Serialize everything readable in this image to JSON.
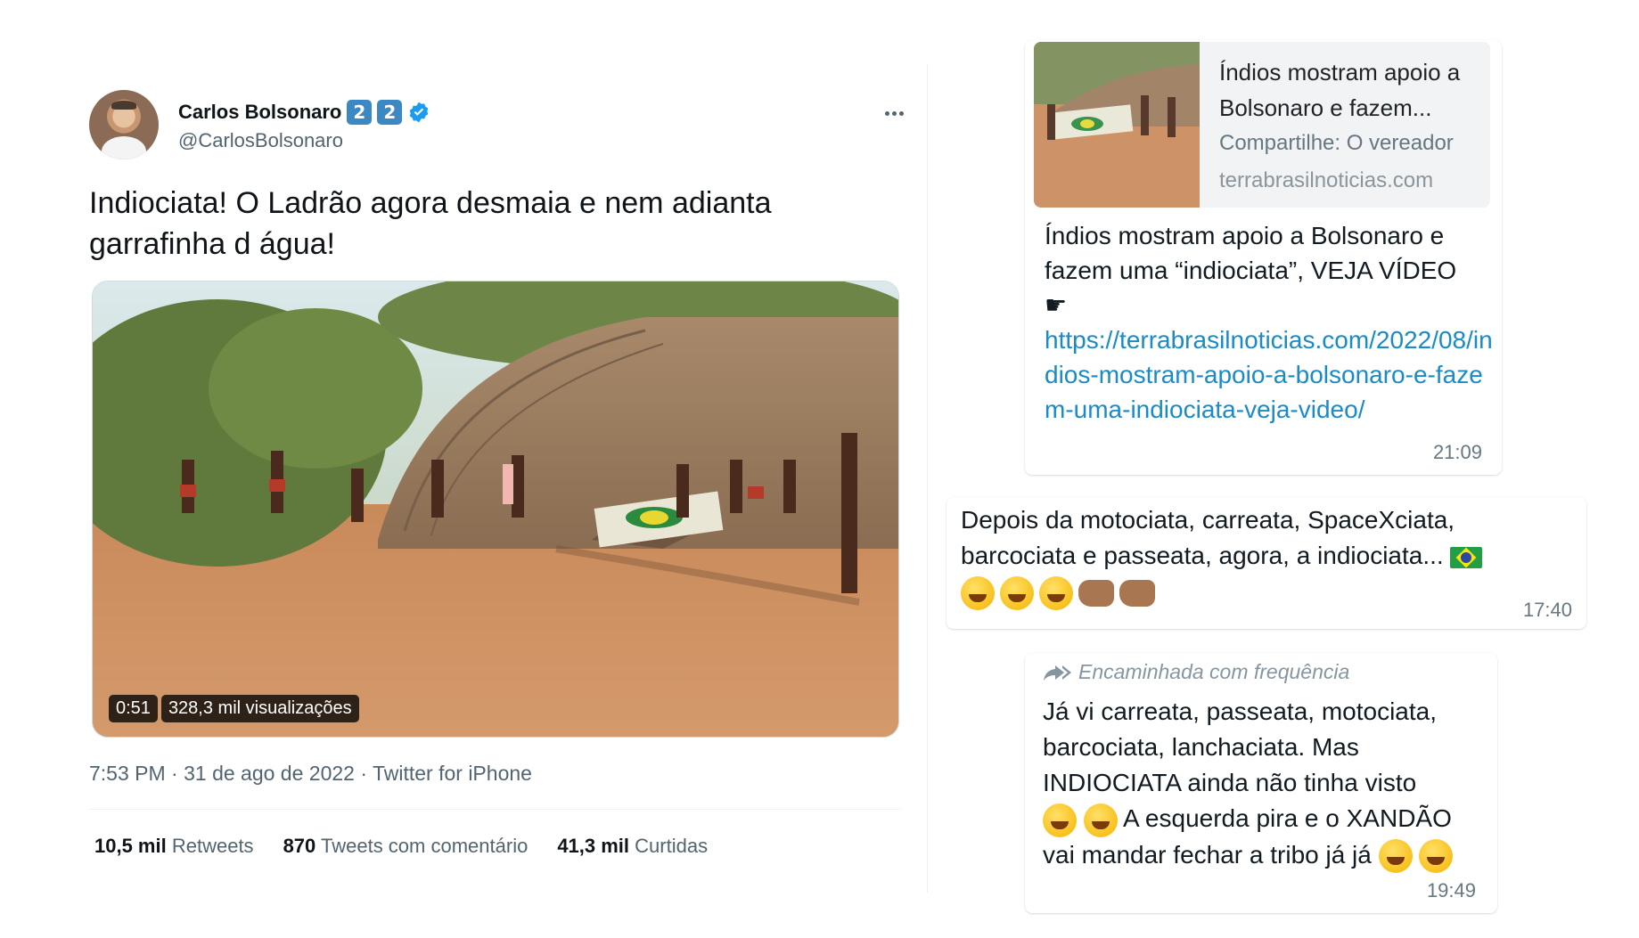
{
  "tweet": {
    "display_name": "Carlos Bolsonaro",
    "name_emoji_keys": [
      "2",
      "2"
    ],
    "handle": "@CarlosBolsonaro",
    "text": "Indiociata! O Ladrão agora desmaia e nem adianta garrafinha d água!",
    "video": {
      "duration": "0:51",
      "views": "328,3 mil visualizações"
    },
    "meta": "7:53 PM · 31 de ago de 2022 · Twitter for iPhone",
    "stats": {
      "retweets_count": "10,5 mil",
      "retweets_label": "Retweets",
      "quotes_count": "870",
      "quotes_label": "Tweets com comentário",
      "likes_count": "41,3 mil",
      "likes_label": "Curtidas"
    },
    "colors": {
      "verified": "#1d9bf0",
      "keycap": "#3b88c3"
    }
  },
  "whatsapp": {
    "message1": {
      "preview_title": "Índios mostram apoio a Bolsonaro e fazem...",
      "preview_description": "Compartilhe: O vereador",
      "preview_domain": "terrabrasilnoticias.com",
      "text": "Índios mostram apoio a Bolsonaro e fazem uma “indiociata”, VEJA VÍDEO",
      "pointer": "☛",
      "link": "https://terrabrasilnoticias.com/2022/08/indios-mostram-apoio-a-bolsonaro-e-fazem-uma-indiociata-veja-video/",
      "time": "21:09"
    },
    "message2": {
      "text": "Depois da motociata, carreata, SpaceXciata, barcociata e passeata, agora, a indiociata...",
      "emojis": [
        "flag-brazil",
        "grinning-face",
        "grinning-sweat-face",
        "tears-of-joy-face",
        "left-fist",
        "right-fist"
      ],
      "time": "17:40"
    },
    "message3": {
      "forwarded_label": "Encaminhada com frequência",
      "text_part1": "Já vi carreata, passeata, motociata, barcociata, lanchaciata. Mas INDIOCIATA ainda não tinha visto",
      "text_part2": "A esquerda pira e o XANDÃO vai mandar fechar a tribo já já",
      "emojis": [
        "hand-over-mouth-face",
        "hand-over-mouth-face",
        "rolling-laughing-face",
        "rolling-laughing-face"
      ],
      "time": "19:49"
    },
    "colors": {
      "link": "#1a8bc6",
      "time": "#667781"
    }
  }
}
